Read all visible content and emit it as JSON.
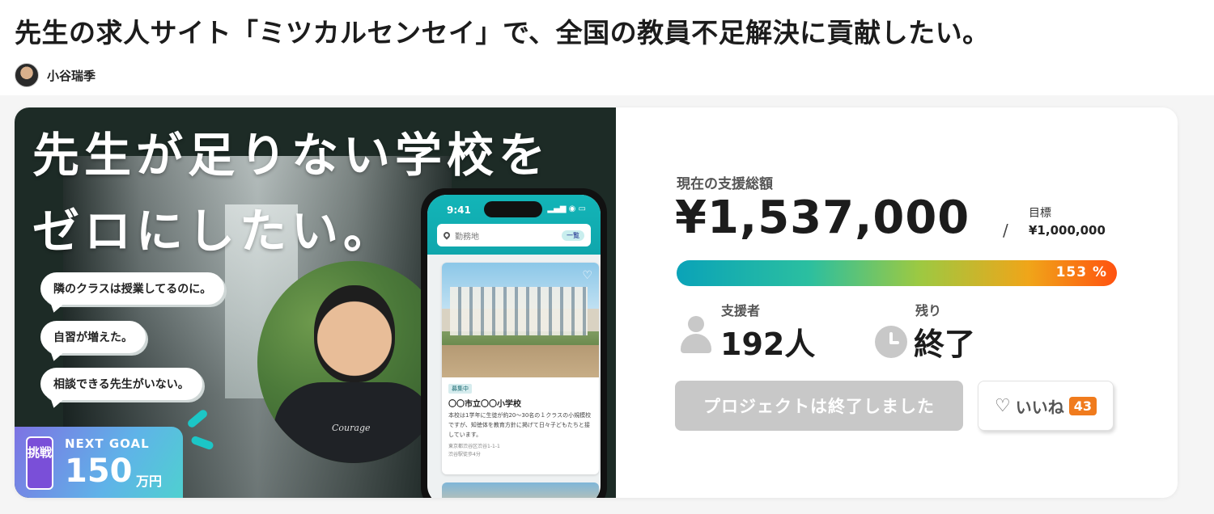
{
  "page": {
    "title": "先生の求人サイト「ミツカルセンセイ」で、全国の教員不足解決に貢献したい。",
    "author_name": "小谷瑞季"
  },
  "hero": {
    "headline_line1": "先生が足りない学校を",
    "headline_line2": "ゼロにしたい。",
    "bubbles": [
      "隣のクラスは授業してるのに。",
      "自習が増えた。",
      "相談できる先生がいない。"
    ],
    "shirt_text": "Courage",
    "phone": {
      "time": "9:41",
      "search_placeholder": "勤務地",
      "search_chip": "一覧",
      "card_tag": "募集中",
      "card_title": "〇〇市立〇〇小学校",
      "card_desc": "本校は1学年に生徒が約20〜30名の１クラスの小規模校ですが、知徳体を教育方針に掲げて日々子どもたちと接しています。",
      "card_address": "東京都渋谷区渋谷1-1-1",
      "card_access": "渋谷駅徒歩4分"
    },
    "goal_badge": {
      "challenge": "挑戦",
      "label": "NEXT GOAL",
      "amount": "150",
      "unit": "万円"
    }
  },
  "stats": {
    "total_label": "現在の支援総額",
    "total_amount": "¥1,537,000",
    "separator": "/",
    "goal_label": "目標",
    "goal_amount": "¥1,000,000",
    "progress_percent": 153,
    "progress_text": "153 %",
    "supporters_label": "支援者",
    "supporters_value": "192人",
    "remaining_label": "残り",
    "remaining_value": "終了",
    "ended_button": "プロジェクトは終了しました",
    "like_label": "いいね",
    "like_count": "43"
  },
  "colors": {
    "progress_start": "#0aa3b8",
    "progress_end": "#ff5210",
    "like_badge": "#f07b1d"
  },
  "icons": [
    "avatar",
    "map-pin-icon",
    "heart-icon",
    "person-icon",
    "clock-icon"
  ]
}
